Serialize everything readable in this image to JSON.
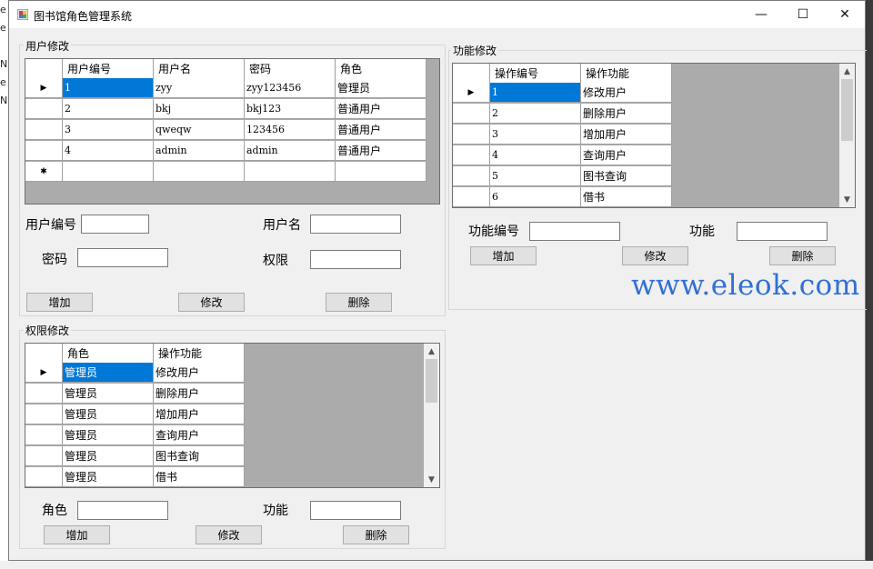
{
  "window": {
    "title": "图书馆角色管理系统",
    "minimize_glyph": "—",
    "maximize_glyph": "☐",
    "close_glyph": "✕"
  },
  "background_fragments": [
    "e",
    "e",
    "Na",
    "e",
    "Na"
  ],
  "user_group": {
    "title": "用户修改",
    "grid": {
      "columns": [
        "用户编号",
        "用户名",
        "密码",
        "角色"
      ],
      "rows": [
        [
          "1",
          "zyy",
          "zyy123456",
          "管理员"
        ],
        [
          "2",
          "bkj",
          "bkj123",
          "普通用户"
        ],
        [
          "3",
          "qweqw",
          "123456",
          "普通用户"
        ],
        [
          "4",
          "admin",
          "admin",
          "普通用户"
        ]
      ],
      "current_row_glyph": "▶",
      "new_row_glyph": "✱"
    },
    "labels": {
      "user_id": "用户编号",
      "username": "用户名",
      "password": "密码",
      "permission": "权限"
    },
    "fields": {
      "user_id": "",
      "username": "",
      "password": "",
      "permission": ""
    },
    "buttons": {
      "add": "增加",
      "edit": "修改",
      "delete": "删除"
    }
  },
  "perm_group": {
    "title": "权限修改",
    "grid": {
      "columns": [
        "角色",
        "操作功能"
      ],
      "rows": [
        [
          "管理员",
          "修改用户"
        ],
        [
          "管理员",
          "删除用户"
        ],
        [
          "管理员",
          "增加用户"
        ],
        [
          "管理员",
          "查询用户"
        ],
        [
          "管理员",
          "图书查询"
        ],
        [
          "管理员",
          "借书"
        ]
      ],
      "current_row_glyph": "▶"
    },
    "labels": {
      "role": "角色",
      "function": "功能"
    },
    "fields": {
      "role": "",
      "function": ""
    },
    "buttons": {
      "add": "增加",
      "edit": "修改",
      "delete": "删除"
    }
  },
  "func_group": {
    "title": "功能修改",
    "grid": {
      "columns": [
        "操作编号",
        "操作功能"
      ],
      "rows": [
        [
          "1",
          "修改用户"
        ],
        [
          "2",
          "删除用户"
        ],
        [
          "3",
          "增加用户"
        ],
        [
          "4",
          "查询用户"
        ],
        [
          "5",
          "图书查询"
        ],
        [
          "6",
          "借书"
        ]
      ],
      "current_row_glyph": "▶"
    },
    "labels": {
      "func_id": "功能编号",
      "function": "功能"
    },
    "fields": {
      "func_id": "",
      "function": ""
    },
    "buttons": {
      "add": "增加",
      "edit": "修改",
      "delete": "删除"
    }
  },
  "scroll_glyphs": {
    "up": "▲",
    "down": "▼"
  },
  "watermark": "www.eleok.com"
}
